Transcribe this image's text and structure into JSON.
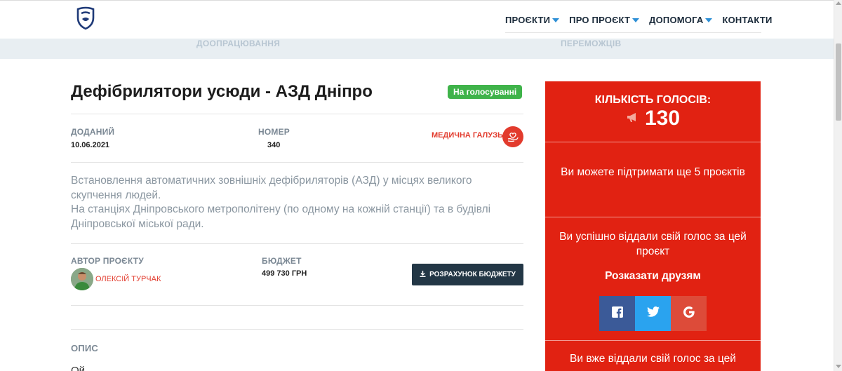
{
  "nav": {
    "items": [
      {
        "label": "ПРОЄКТИ",
        "has_caret": true
      },
      {
        "label": "ПРО ПРОЄКТ",
        "has_caret": true
      },
      {
        "label": "ДОПОМОГА",
        "has_caret": true
      },
      {
        "label": "КОНТАКТИ",
        "has_caret": false
      }
    ]
  },
  "stages": {
    "left": "ДООПРАЦЮВАННЯ",
    "right": "ПЕРЕМОЖЦІВ"
  },
  "project": {
    "title": "Дефібрилятори усюди - АЗД Дніпро",
    "status_badge": "На голосуванні",
    "added_label": "ДОДАНИЙ",
    "added_value": "10.06.2021",
    "number_label": "НОМЕР",
    "number_value": "340",
    "category": "МЕДИЧНА ГАЛУЗЬ",
    "description_1": "Встановлення автоматичних зовнішніх дефібриляторів (АЗД) у місцях великого скупчення людей.",
    "description_2": "На станціях Дніпровського метрополітену (по одному на кожній станції) та в будівлі Дніпровської міської ради.",
    "author_label": "АВТОР ПРОЄКТУ",
    "author_name": "ОЛЕКСІЙ ТУРЧАК",
    "budget_label": "БЮДЖЕТ",
    "budget_value": "499 730 ГРН",
    "budget_button": "РОЗРАХУНОК БЮДЖЕТУ",
    "section_label": "ОПИС",
    "section_text_fragment": "Ой"
  },
  "sidebar": {
    "votes_label": "КІЛЬКІСТЬ ГОЛОСІВ:",
    "votes_count": "130",
    "remaining_text": "Ви можете підтримати ще 5 проєктів",
    "voted_text": "Ви успішно віддали свій голос за цей проєкт",
    "share_title": "Розказати друзям",
    "already_voted_text": "Ви вже віддали свій голос за цей"
  },
  "colors": {
    "accent_red": "#e12212",
    "badge_green": "#3fb34a",
    "nav_caret_blue": "#2d8fd6",
    "button_dark": "#233746",
    "facebook": "#3b5a98",
    "twitter": "#2aa3ef",
    "google": "#dd4b39"
  }
}
